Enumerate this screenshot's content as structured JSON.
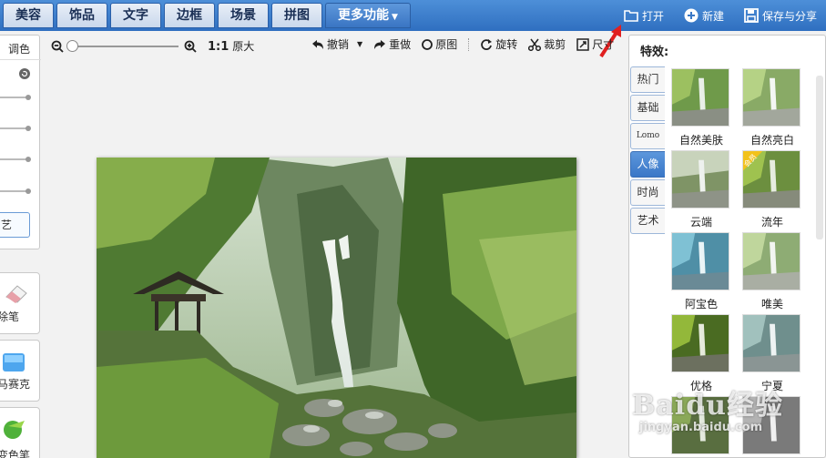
{
  "nav": {
    "tabs": [
      "美容",
      "饰品",
      "文字",
      "边框",
      "场景",
      "拼图"
    ],
    "more": "更多功能"
  },
  "top_actions": {
    "open": "打开",
    "new": "新建",
    "save": "保存与分享"
  },
  "left_panel": {
    "tune": "调色",
    "art": "艺",
    "tools": [
      "除笔",
      "马赛克",
      "变色笔"
    ]
  },
  "canvas_toolbar": {
    "ratio_label": "1:1",
    "original_size": "原大",
    "undo": "撤销",
    "redo": "重做",
    "original": "原图",
    "rotate": "旋转",
    "crop": "裁剪",
    "size": "尺寸"
  },
  "effects_panel": {
    "title": "特效:",
    "categories": [
      "热门",
      "基础",
      "Lomo",
      "人像",
      "时尚",
      "艺术"
    ],
    "active_category": "人像",
    "effects": [
      "自然美肤",
      "自然亮白",
      "云端",
      "流年",
      "阿宝色",
      "唯美",
      "优格",
      "宁夏"
    ],
    "badge": "会员"
  },
  "watermark": {
    "line1": "Baidu经验",
    "line2": "jingyan.baidu.com"
  },
  "colors": {
    "nav_blue": "#3a78c6",
    "active_tab": "#4a86d2",
    "annotation_red": "#e02020"
  }
}
